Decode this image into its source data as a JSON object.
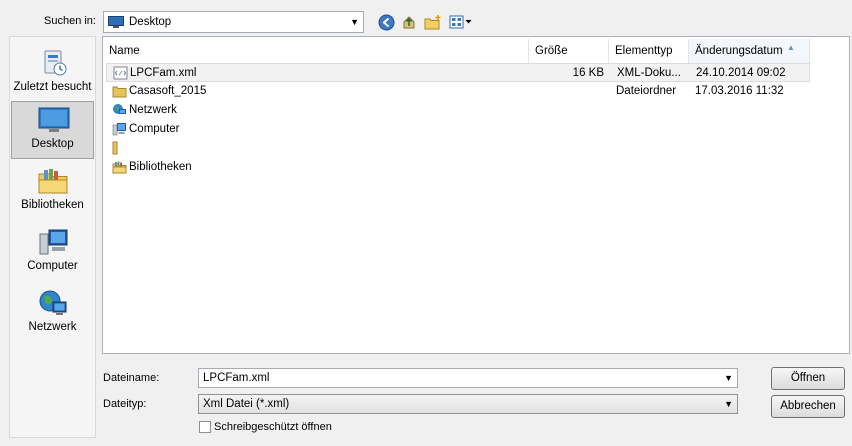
{
  "lookin": {
    "label": "Suchen in:",
    "value": "Desktop"
  },
  "places": [
    {
      "label": "Zuletzt besucht",
      "icon": "recent-places-icon"
    },
    {
      "label": "Desktop",
      "icon": "desktop-icon",
      "selected": true
    },
    {
      "label": "Bibliotheken",
      "icon": "libraries-icon"
    },
    {
      "label": "Computer",
      "icon": "computer-icon"
    },
    {
      "label": "Netzwerk",
      "icon": "network-icon"
    }
  ],
  "columns": {
    "name": "Name",
    "size": "Größe",
    "type": "Elementtyp",
    "date": "Änderungsdatum"
  },
  "files": [
    {
      "name": "LPCFam.xml",
      "size": "16 KB",
      "type": "XML-Doku...",
      "date": "24.10.2014 09:02",
      "icon": "xml-file-icon",
      "selected": true
    },
    {
      "name": "Casasoft_2015",
      "size": "",
      "type": "Dateiordner",
      "date": "17.03.2016 11:32",
      "icon": "folder-icon"
    },
    {
      "name": "Netzwerk",
      "size": "",
      "type": "",
      "date": "",
      "icon": "network-icon"
    },
    {
      "name": "Computer",
      "size": "",
      "type": "",
      "date": "",
      "icon": "computer-icon"
    },
    {
      "name": "",
      "size": "",
      "type": "",
      "date": "",
      "icon": "folder-icon"
    },
    {
      "name": "Bibliotheken",
      "size": "",
      "type": "",
      "date": "",
      "icon": "libraries-icon"
    }
  ],
  "filename": {
    "label": "Dateiname:",
    "value": "LPCFam.xml"
  },
  "filetype": {
    "label": "Dateityp:",
    "value": "Xml Datei (*.xml)"
  },
  "readonly": {
    "label": "Schreibgeschützt öffnen",
    "checked": false
  },
  "buttons": {
    "open": "Öffnen",
    "cancel": "Abbrechen"
  },
  "colors": {
    "accent": "#3a78c3",
    "folder": "#e8c35a"
  }
}
